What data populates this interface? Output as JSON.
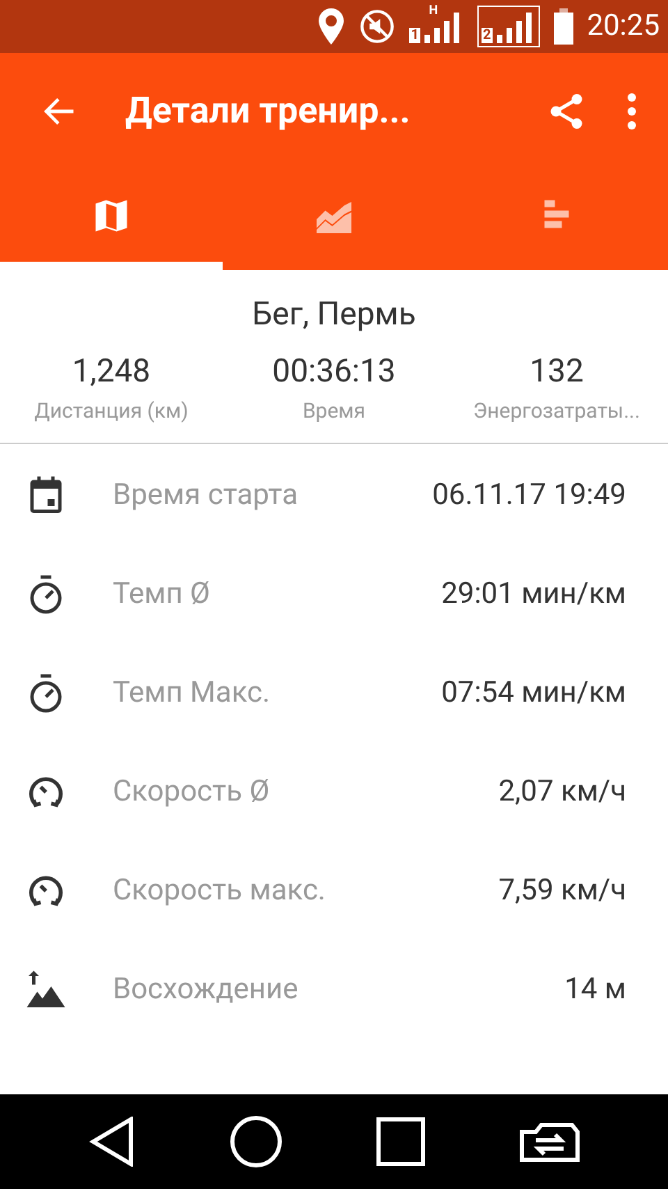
{
  "status_bar": {
    "network_type": "H",
    "sim_1": "1",
    "sim_2": "2",
    "time": "20:25"
  },
  "app_bar": {
    "title": "Детали тренир..."
  },
  "tabs": [
    {
      "selected": true
    },
    {
      "selected": false
    },
    {
      "selected": false
    }
  ],
  "summary": {
    "title": "Бег, Пермь",
    "stats": [
      {
        "value": "1,248",
        "label": "Дистанция (км)"
      },
      {
        "value": "00:36:13",
        "label": "Время"
      },
      {
        "value": "132",
        "label": "Энергозатраты..."
      }
    ]
  },
  "details": [
    {
      "label": "Время старта",
      "value": "06.11.17 19:49"
    },
    {
      "label": "Темп Ø",
      "value": "29:01 мин/км"
    },
    {
      "label": "Темп Макс.",
      "value": "07:54 мин/км"
    },
    {
      "label": "Скорость Ø",
      "value": "2,07 км/ч"
    },
    {
      "label": "Скорость макс.",
      "value": "7,59 км/ч"
    },
    {
      "label": "Восхождение",
      "value": "14 м"
    }
  ]
}
